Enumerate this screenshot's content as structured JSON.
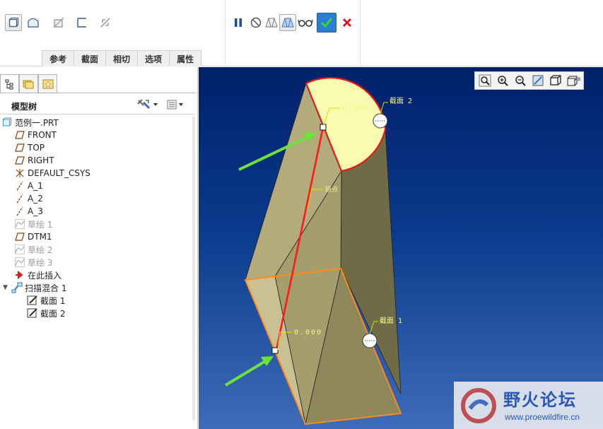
{
  "ribbon": {
    "tabs": [
      "参考",
      "截面",
      "相切",
      "选项",
      "属性"
    ]
  },
  "panel": {
    "tree_title": "模型树",
    "nodes": [
      {
        "label": "范例一.PRT",
        "icon": "part-icon"
      },
      {
        "label": "FRONT",
        "icon": "datum-plane-icon"
      },
      {
        "label": "TOP",
        "icon": "datum-plane-icon"
      },
      {
        "label": "RIGHT",
        "icon": "datum-plane-icon"
      },
      {
        "label": "DEFAULT_CSYS",
        "icon": "csys-icon"
      },
      {
        "label": "A_1",
        "icon": "datum-axis-icon"
      },
      {
        "label": "A_2",
        "icon": "datum-axis-icon"
      },
      {
        "label": "A_3",
        "icon": "datum-axis-icon"
      },
      {
        "label": "草绘 1",
        "icon": "sketch-icon"
      },
      {
        "label": "DTM1",
        "icon": "datum-plane-icon"
      },
      {
        "label": "草绘 2",
        "icon": "sketch-icon"
      },
      {
        "label": "草绘 3",
        "icon": "sketch-icon"
      },
      {
        "label": "在此插入",
        "icon": "insert-here-arrow-icon"
      },
      {
        "label": "扫描混合 1",
        "icon": "swept-blend-icon"
      },
      {
        "label": "截面 1",
        "icon": "section-edit-icon"
      },
      {
        "label": "截面 2",
        "icon": "section-edit-icon"
      }
    ]
  },
  "viewport": {
    "labels": {
      "section2": "截面 2",
      "section1": "截面 1",
      "origin_top": "0.000",
      "origin_bottom": "0.000",
      "trajectory": "原点"
    },
    "watermark": {
      "title": "野火论坛",
      "url": "www.proewildfire.cn"
    },
    "colors": {
      "background_top": "#00206a",
      "surface": "#b5ad7d",
      "section_fill": "#fafab0",
      "trajectory": "#ff1a1a",
      "section_outline": "#ff8a1a",
      "arrow": "#6ce23a"
    }
  },
  "toolbar_icons": [
    "solid-icon",
    "surface-icon",
    "remove-material-icon",
    "thicken-icon",
    "flip-icon",
    "pause-icon",
    "no-preview-icon",
    "verify-mode-icon",
    "feature-preview-icon",
    "glasses-preview-icon",
    "confirm-icon",
    "cancel-icon"
  ]
}
